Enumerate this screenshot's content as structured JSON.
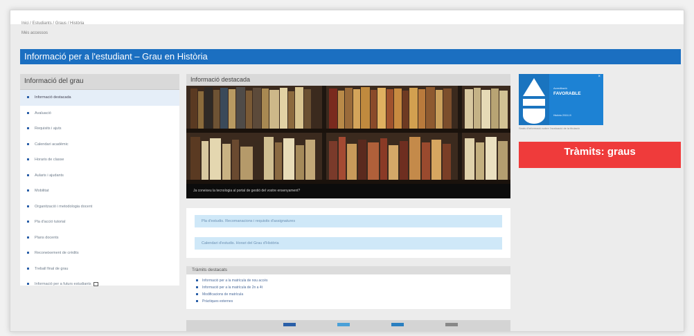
{
  "breadcrumb": "Inici / Estudiants / Graus / Història",
  "sublink": "Més accessos",
  "page_title": "Informació per a l'estudiant – Grau en Història",
  "sidebar": {
    "title": "Informació del grau",
    "items": [
      {
        "label": "Informació destacada",
        "active": true
      },
      {
        "label": "Avaluació"
      },
      {
        "label": "Requisits i ajuts"
      },
      {
        "label": "Calendari acadèmic"
      },
      {
        "label": "Horaris de classe"
      },
      {
        "label": "Aularis i ajudants"
      },
      {
        "label": "Mobilitat"
      },
      {
        "label": "Organització i metodologia docent"
      },
      {
        "label": "Pla d'acció tutorial"
      },
      {
        "label": "Plans docents"
      },
      {
        "label": "Reconeixement de crèdits"
      },
      {
        "label": "Treball final de grau"
      },
      {
        "label": "Informació per a futurs estudiants",
        "external": true
      }
    ]
  },
  "featured": {
    "title": "Informació destacada",
    "image_caption": "Ja coneixeu la tecnologia al portal de gestió del vostre ensenyament?"
  },
  "info_links": [
    "Pla d'estudis. Recomanacions i requisits d'assignatures",
    "Calendari d'estudis. Horari del Grau d'Història"
  ],
  "tramits": {
    "title": "Tràmits destacats",
    "items": [
      "Informació per a la matrícula de nou accés",
      "Informació per a la matrícula de 2n a 4t",
      "Modificacions de matrícula",
      "Pràctiques externes"
    ]
  },
  "aqu": {
    "line1": "Acreditació",
    "line2": "FAVORABLE",
    "line3": "Història 2018-19",
    "caption": "Seals d'informació sobre l'avaluació de la titulació",
    "close": "×"
  },
  "tramits_button": "Tràmits: graus",
  "icons": {
    "bullet": "square-bullet-icon",
    "external": "external-link-icon",
    "close": "close-icon"
  },
  "colors": {
    "title_bar": "#1b6fc1",
    "tramits_button": "#ef3b3b",
    "info_link_bg": "#cfe8f8",
    "aqu_blue": "#1d82d4"
  }
}
